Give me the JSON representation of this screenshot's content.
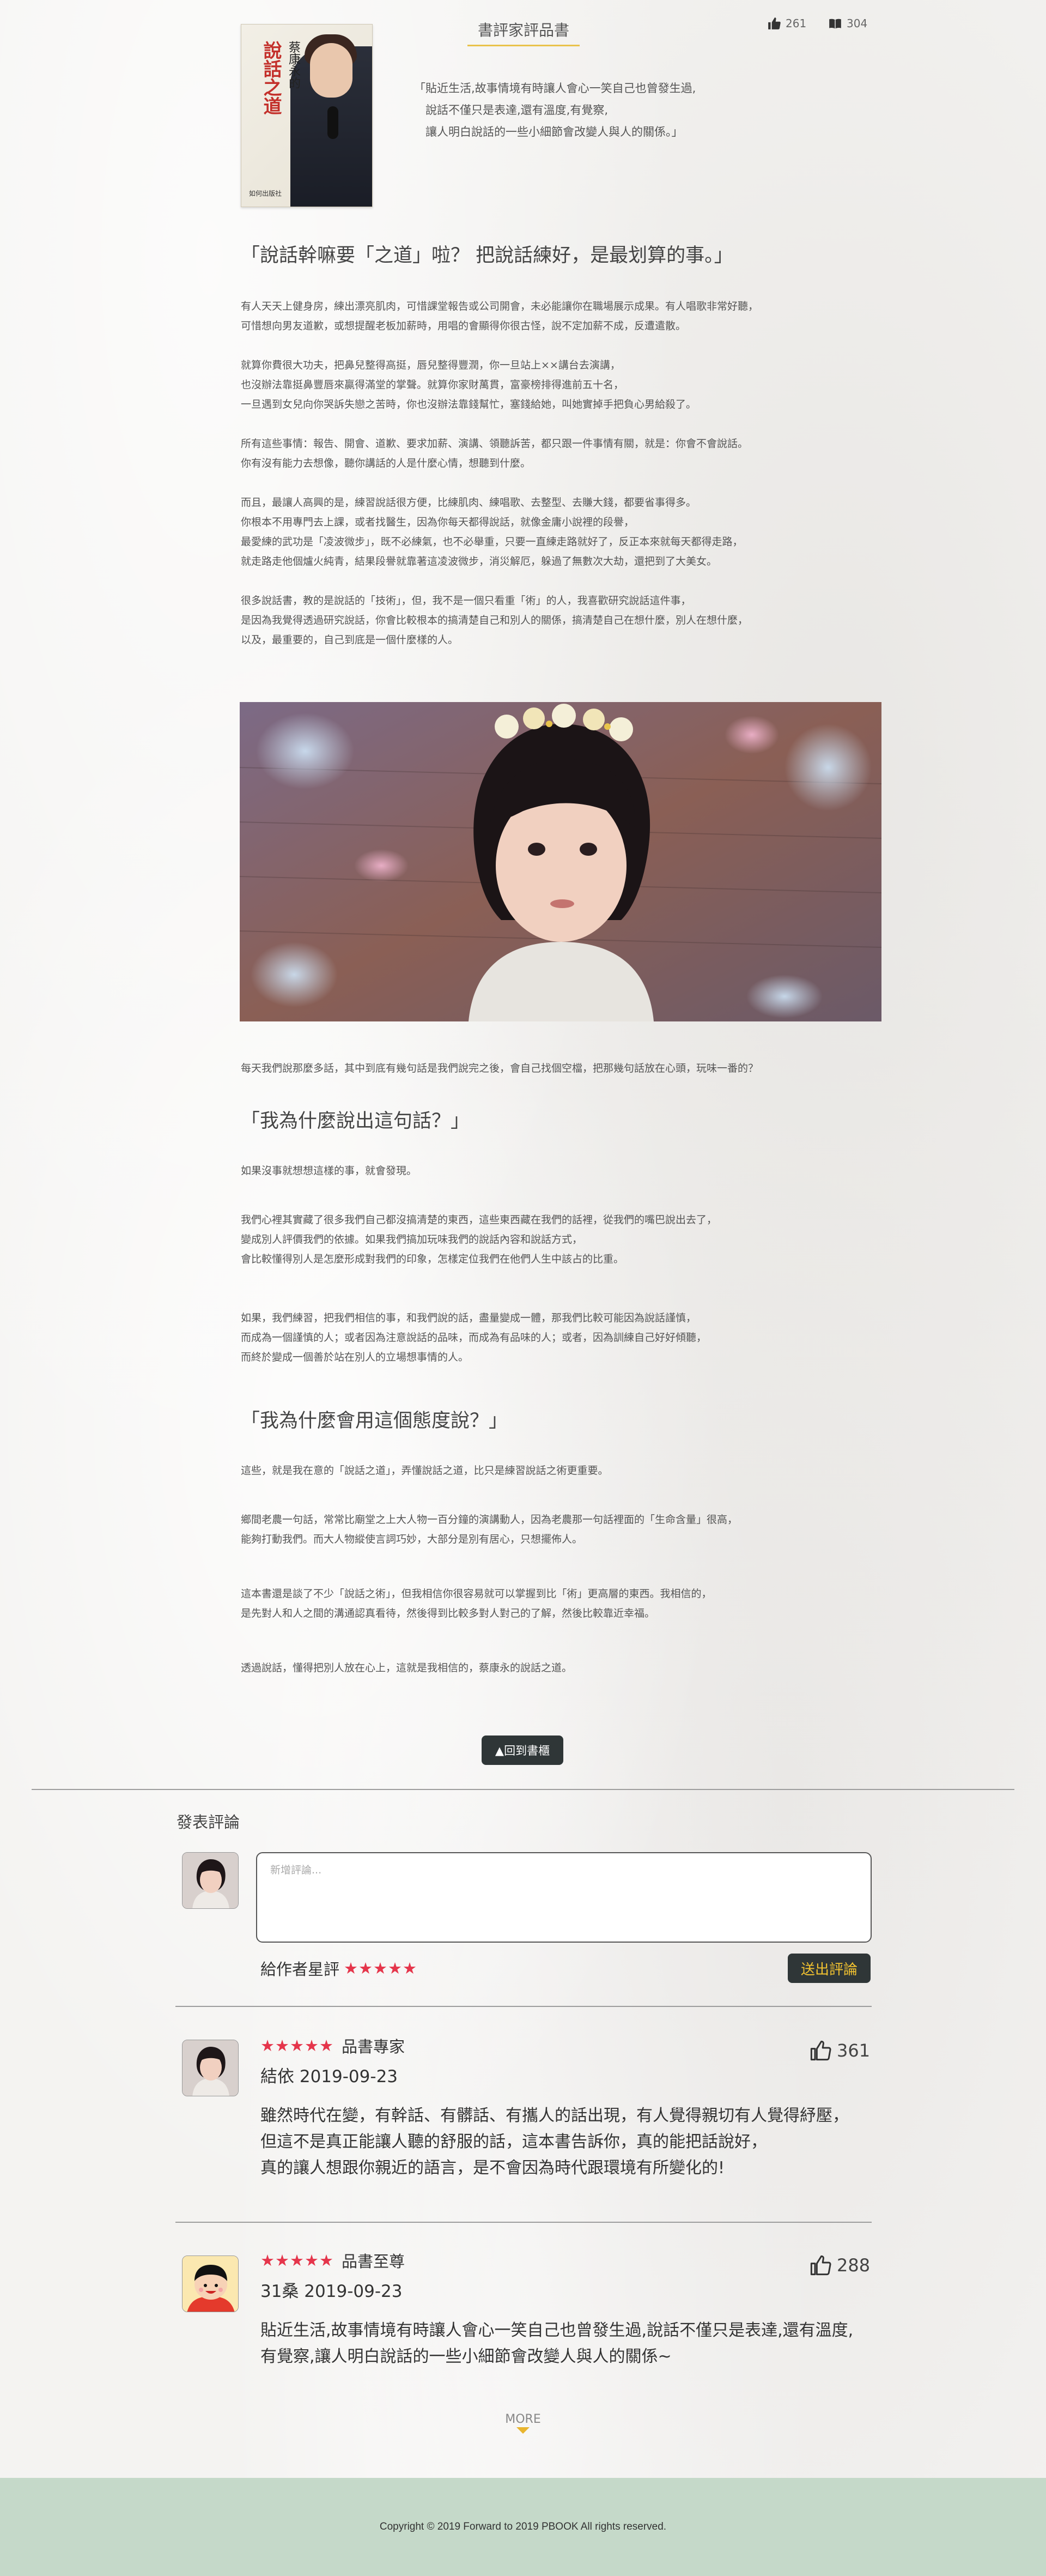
{
  "header": {
    "section_title": "書評家評品書",
    "likes": "261",
    "books": "304"
  },
  "book_cover": {
    "title": "說話之道",
    "author": "蔡康永的",
    "foot": "如何出版社"
  },
  "intro_quote": "「貼近生活,故事情境有時讓人會心一笑自己也曾發生過,\n　說話不僅只是表達,還有溫度,有覺察,\n　讓人明白說話的一些小細節會改變人與人的關係。」",
  "article": {
    "heading1": "「說話幹嘛要「之道」啦？ 把說話練好，是最划算的事。」",
    "p1": "有人天天上健身房，練出漂亮肌肉，可惜課堂報告或公司開會，未必能讓你在職場展示成果。有人唱歌非常好聽，\n可惜想向男友道歉，或想提醒老板加薪時，用唱的會顯得你很古怪，說不定加薪不成，反遭遣散。",
    "p2": "就算你費很大功夫，把鼻兒整得高挺，唇兒整得豐潤，你一旦站上××講台去演講，\n也沒辦法靠挺鼻豐唇來贏得滿堂的掌聲。就算你家財萬貫，富豪榜排得進前五十名，\n一旦遇到女兒向你哭訴失戀之苦時，你也沒辦法靠錢幫忙，塞錢給她，叫她實掉手把負心男給殺了。",
    "p3": "所有這些事情：報告、開會、道歉、要求加薪、演講、領聽訴苦，都只跟一件事情有關，就是：你會不會說話。\n你有沒有能力去想像，聽你講話的人是什麼心情，想聽到什麼。",
    "p4": "而且，最讓人高興的是，練習說話很方便，比練肌肉、練唱歌、去整型、去賺大錢，都要省事得多。\n你根本不用專門去上課，或者找醫生，因為你每天都得說話，就像金庸小說裡的段譽，\n最愛練的武功是「凌波微步」，既不必練氣，也不必舉重，只要一直練走路就好了，反正本來就每天都得走路，\n就走路走他個爐火純青，結果段譽就靠著這凌波微步，消災解厄，躲過了無數次大劫，還把到了大美女。",
    "p5": "很多說話書，教的是說話的「技術」，但，我不是一個只看重「術」的人，我喜歡研究說話這件事，\n是因為我覺得透過研究說話，你會比較根本的搞清楚自己和別人的關係，搞清楚自己在想什麼，別人在想什麼，\n以及，最重要的，自己到底是一個什麼樣的人。",
    "caption": "每天我們說那麼多話，其中到底有幾句話是我們說完之後，會自己找個空檔，把那幾句話放在心頭，玩味一番的？",
    "heading2": "「我為什麼說出這句話？」",
    "p6": "如果沒事就想想這樣的事，就會發現。",
    "p7": "我們心裡其實藏了很多我們自己都沒搞清楚的東西，這些東西藏在我們的話裡，從我們的嘴巴說出去了，\n變成別人評價我們的依據。如果我們搞加玩味我們的說話內容和說話方式，\n會比較懂得別人是怎麼形成對我們的印象，怎樣定位我們在他們人生中該占的比重。",
    "p8": "如果，我們練習，把我們相信的事，和我們說的話，盡量變成一體，那我們比較可能因為說話謹慎，\n而成為一個謹慎的人；或者因為注意說話的品味，而成為有品味的人；或者，因為訓練自己好好傾聽，\n而終於變成一個善於站在別人的立場想事情的人。",
    "heading3": "「我為什麼會用這個態度說？」",
    "p9": "這些，就是我在意的「說話之道」，弄懂說話之道，比只是練習說話之術更重要。",
    "p10": "鄉間老農一句話，常常比廟堂之上大人物一百分鐘的演講動人，因為老農那一句話裡面的「生命含量」很高，\n能夠打動我們。而大人物縱使言詞巧妙，大部分是別有居心，只想擺佈人。",
    "p11": "這本書還是談了不少「說話之術」，但我相信你很容易就可以掌握到比「術」更高層的東西。我相信的，\n是先對人和人之間的溝通認真看待，然後得到比較多對人對己的了解，然後比較靠近幸福。",
    "p12": "透過說話，懂得把別人放在心上，這就是我相信的，蔡康永的說話之道。"
  },
  "back_button": "▲回到書櫃",
  "comment_form": {
    "title": "發表評論",
    "placeholder": "新增評論...",
    "rate_label": "給作者星評",
    "stars": "★★★★★",
    "submit": "送出評論"
  },
  "reviews": [
    {
      "stars": "★★★★★",
      "badge": "品書專家",
      "meta": "結依 2019-09-23",
      "likes": "361",
      "body": "雖然時代在變，有幹話、有髒話、有攜人的話出現，有人覺得親切有人覺得紓壓，\n但這不是真正能讓人聽的舒服的話，這本書告訴你，真的能把話說好，\n真的讓人想跟你親近的語言，是不會因為時代跟環境有所變化的!"
    },
    {
      "stars": "★★★★★",
      "badge": "品書至尊",
      "meta": "31桑 2019-09-23",
      "likes": "288",
      "body": "貼近生活,故事情境有時讓人會心一笑自己也曾發生過,說話不僅只是表達,還有溫度,\n有覺察,讓人明白說話的一些小細節會改變人與人的關係~"
    }
  ],
  "more_label": "MORE",
  "footer": "Copyright © 2019 Forward to 2019 PBOOK All rights reserved."
}
